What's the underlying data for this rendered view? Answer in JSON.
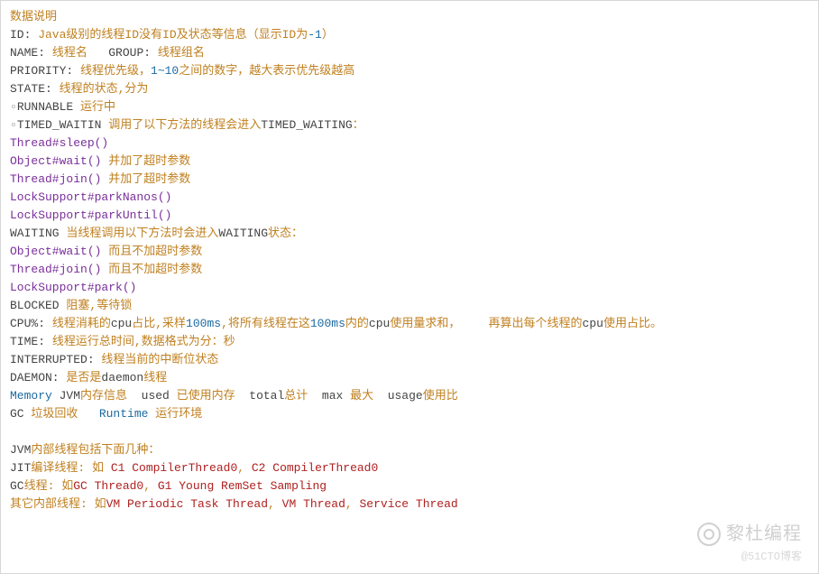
{
  "title": "数据说明",
  "id": {
    "label": "ID:",
    "text": " Java级别的线程ID没有ID及状态等信息（显示ID为",
    "num": "-1",
    "tail": "）"
  },
  "name": {
    "label": "NAME:",
    "text": " 线程名   ",
    "label2": "GROUP:",
    "text2": " 线程组名"
  },
  "priority": {
    "label": "PRIORITY:",
    "text1": " 线程优先级，",
    "range": "1~10",
    "text2": "之间的数字，越大表示优先级越高"
  },
  "state": {
    "label": "STATE:",
    "text": " 线程的状态,分为"
  },
  "runnable": {
    "name": "RUNNABLE",
    "text": " 运行中"
  },
  "timedw": {
    "name": "TIMED_WAITIN",
    "text": " 调用了以下方法的线程会进入",
    "kw": "TIMED_WAITING",
    "tail": "："
  },
  "m1": "Thread#sleep()",
  "m2": {
    "call": "Object#wait()",
    "note": " 并加了超时参数"
  },
  "m3": {
    "call": "Thread#join()",
    "note": " 并加了超时参数"
  },
  "m4": "LockSupport#parkNanos()",
  "m5": "LockSupport#parkUntil()",
  "waiting": {
    "name": "WAITING",
    "text": " 当线程调用以下方法时会进入",
    "kw": "WAITING",
    "tail": "状态："
  },
  "m6": {
    "call": "Object#wait()",
    "note": " 而且不加超时参数"
  },
  "m7": {
    "call": "Thread#join()",
    "note": " 而且不加超时参数"
  },
  "m8": "LockSupport#park()",
  "blocked": {
    "name": "BLOCKED",
    "text": " 阻塞,等待锁"
  },
  "cpu": {
    "label": "CPU%:",
    "t1": " 线程消耗的",
    "kw1": "cpu",
    "t2": "占比,采样",
    "n1": "100ms",
    "t3": ",将所有线程在这",
    "n2": "100ms",
    "t4": "内的",
    "kw2": "cpu",
    "t5": "使用量求和，    再算出每个线程的",
    "kw3": "cpu",
    "t6": "使用占比。"
  },
  "time": {
    "label": "TIME:",
    "text": " 线程运行总时间,数据格式为分：秒"
  },
  "intr": {
    "label": "INTERRUPTED:",
    "text": " 线程当前的中断位状态"
  },
  "daemon": {
    "label": "DAEMON:",
    "t1": " 是否是",
    "kw": "daemon",
    "t2": "线程"
  },
  "memory": {
    "a": "Memory",
    "b": " JVM",
    "c": "内存信息  ",
    "d": "used",
    "e": " 已使用内存  ",
    "f": "total",
    "g": "总计  ",
    "h": "max",
    "i": " 最大  ",
    "j": "usage",
    "k": "使用比"
  },
  "gc": {
    "a": "GC",
    "b": " 垃圾回收   ",
    "c": "Runtime",
    "d": " 运行环境"
  },
  "internal_hdr": {
    "a": "JVM",
    "b": "内部线程包括下面几种："
  },
  "jit": {
    "a": "JIT",
    "b": "编译线程: 如",
    "c": " C1 CompilerThread0",
    "d": ",",
    "e": " C2 CompilerThread0"
  },
  "gct": {
    "a": "GC",
    "b": "线程: 如",
    "c": "GC Thread0",
    "d": ",",
    "e": " G1 Young RemSet Sampling"
  },
  "other": {
    "a": "其它内部线程: 如",
    "b": "VM Periodic Task Thread",
    "c": ",",
    "d": " VM Thread",
    "e": ",",
    "f": " Service Thread"
  },
  "watermark1": "黎杜编程",
  "watermark2": "@51CTO博客"
}
